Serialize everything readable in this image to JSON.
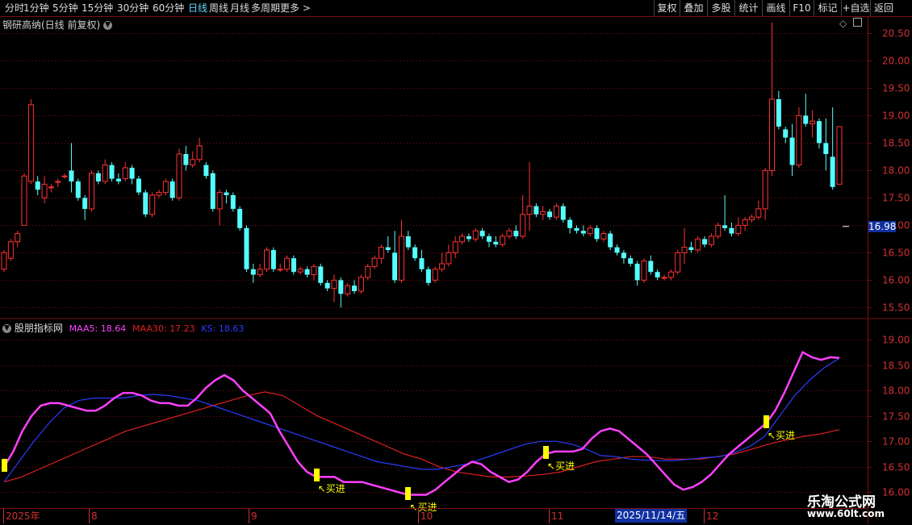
{
  "toolbar": {
    "timeframes": [
      "分时",
      "1分钟",
      "5分钟",
      "15分钟",
      "30分钟",
      "60分钟",
      "日线",
      "周线",
      "月线",
      "多周期",
      "更多 >"
    ],
    "right_buttons": [
      "复权",
      "叠加",
      "多股",
      "统计",
      "画线",
      "F10",
      "标记",
      "+自选",
      "返回"
    ]
  },
  "main_panel": {
    "title": "钢研高纳(日线 前复权)",
    "price_labels": [
      "20.50",
      "20.00",
      "19.50",
      "19.00",
      "18.50",
      "18.00",
      "17.50",
      "17.00",
      "16.50",
      "16.00",
      "15.50"
    ],
    "current_price": "16.98"
  },
  "indicator_panel": {
    "title": "股朋指标网",
    "maa5_text": "MAA5: 18.64",
    "maa30_text": "MAA30: 17.23",
    "ks_text": "KS: 18.63",
    "y_labels": [
      "19.00",
      "18.50",
      "18.00",
      "17.50",
      "17.00",
      "16.50",
      "16.00"
    ],
    "signal_label": "↖买进"
  },
  "date_axis": {
    "labels": [
      "2025年",
      "8",
      "9",
      "10",
      "11",
      "12"
    ],
    "highlight": "2025/11/14/五"
  },
  "watermark": {
    "name": "乐淘公式网",
    "url": "www.60lt.com"
  },
  "colors": {
    "up": "#ff3232",
    "down": "#54ffff",
    "grid": "#7a1010",
    "maa5": "#ff40ff",
    "maa30": "#e02020",
    "ks": "#2a3cff",
    "signal": "#ffff00"
  },
  "chart_data": {
    "type": "candlestick",
    "candles": [
      [
        16.2,
        16.5,
        16.15,
        16.55
      ],
      [
        16.4,
        16.7,
        16.35,
        16.75
      ],
      [
        16.7,
        16.85,
        16.6,
        16.9
      ],
      [
        17.0,
        17.9,
        17.0,
        17.95
      ],
      [
        17.8,
        19.2,
        17.75,
        19.3
      ],
      [
        17.8,
        17.65,
        17.55,
        17.9
      ],
      [
        17.5,
        17.75,
        17.4,
        17.9
      ],
      [
        17.7,
        17.7,
        17.6,
        17.75
      ],
      [
        17.8,
        17.8,
        17.7,
        17.85
      ],
      [
        17.9,
        17.9,
        17.85,
        17.95
      ],
      [
        18.0,
        17.8,
        17.6,
        18.5
      ],
      [
        17.8,
        17.5,
        17.45,
        17.85
      ],
      [
        17.5,
        17.3,
        17.1,
        17.55
      ],
      [
        17.3,
        17.95,
        17.25,
        18.0
      ],
      [
        17.95,
        17.8,
        17.75,
        18.0
      ],
      [
        17.8,
        18.1,
        17.75,
        18.2
      ],
      [
        18.1,
        17.85,
        17.8,
        18.15
      ],
      [
        17.85,
        17.8,
        17.75,
        17.95
      ],
      [
        17.85,
        18.05,
        17.8,
        18.15
      ],
      [
        18.05,
        17.85,
        17.75,
        18.1
      ],
      [
        17.85,
        17.6,
        17.55,
        17.9
      ],
      [
        17.6,
        17.2,
        17.15,
        17.65
      ],
      [
        17.2,
        17.55,
        17.15,
        17.6
      ],
      [
        17.55,
        17.6,
        17.5,
        17.65
      ],
      [
        17.6,
        17.8,
        17.55,
        17.85
      ],
      [
        17.8,
        17.5,
        17.45,
        17.85
      ],
      [
        17.5,
        18.3,
        17.45,
        18.4
      ],
      [
        18.3,
        18.1,
        18.0,
        18.45
      ],
      [
        18.1,
        18.2,
        18.05,
        18.35
      ],
      [
        18.2,
        18.45,
        18.15,
        18.6
      ],
      [
        18.1,
        17.9,
        17.85,
        18.15
      ],
      [
        17.95,
        17.3,
        17.25,
        18.0
      ],
      [
        17.3,
        17.6,
        17.0,
        17.65
      ],
      [
        17.6,
        17.55,
        17.4,
        17.65
      ],
      [
        17.55,
        17.3,
        17.25,
        17.6
      ],
      [
        17.3,
        16.95,
        16.9,
        17.35
      ],
      [
        16.95,
        16.2,
        16.15,
        17.0
      ],
      [
        16.2,
        16.1,
        15.95,
        16.3
      ],
      [
        16.1,
        16.2,
        16.05,
        16.3
      ],
      [
        16.2,
        16.55,
        16.15,
        16.6
      ],
      [
        16.55,
        16.2,
        16.15,
        16.6
      ],
      [
        16.2,
        16.2,
        16.15,
        16.3
      ],
      [
        16.2,
        16.4,
        16.15,
        16.45
      ],
      [
        16.4,
        16.15,
        16.1,
        16.45
      ],
      [
        16.15,
        16.2,
        16.1,
        16.25
      ],
      [
        16.2,
        16.1,
        16.05,
        16.25
      ],
      [
        16.1,
        16.25,
        16.0,
        16.3
      ],
      [
        16.25,
        15.95,
        15.9,
        16.3
      ],
      [
        15.95,
        15.85,
        15.8,
        16.0
      ],
      [
        15.85,
        16.0,
        15.6,
        16.1
      ],
      [
        16.0,
        15.75,
        15.5,
        16.05
      ],
      [
        15.75,
        15.9,
        15.7,
        15.95
      ],
      [
        15.9,
        15.8,
        15.75,
        16.0
      ],
      [
        15.8,
        16.05,
        15.75,
        16.1
      ],
      [
        16.05,
        16.25,
        16.0,
        16.3
      ],
      [
        16.25,
        16.4,
        16.2,
        16.45
      ],
      [
        16.4,
        16.6,
        16.3,
        16.65
      ],
      [
        16.6,
        16.55,
        16.5,
        16.8
      ],
      [
        16.5,
        16.0,
        15.95,
        16.9
      ],
      [
        16.0,
        16.8,
        15.95,
        17.1
      ],
      [
        16.8,
        16.6,
        16.55,
        16.9
      ],
      [
        16.6,
        16.4,
        16.35,
        16.65
      ],
      [
        16.4,
        16.2,
        16.15,
        16.55
      ],
      [
        16.2,
        15.95,
        15.9,
        16.25
      ],
      [
        16.0,
        16.2,
        15.95,
        16.25
      ],
      [
        16.2,
        16.3,
        16.15,
        16.5
      ],
      [
        16.3,
        16.5,
        16.25,
        16.65
      ],
      [
        16.5,
        16.7,
        16.4,
        16.8
      ],
      [
        16.7,
        16.8,
        16.65,
        16.85
      ],
      [
        16.8,
        16.75,
        16.7,
        16.85
      ],
      [
        16.75,
        16.9,
        16.7,
        16.95
      ],
      [
        16.9,
        16.8,
        16.75,
        16.95
      ],
      [
        16.8,
        16.7,
        16.6,
        16.85
      ],
      [
        16.7,
        16.65,
        16.6,
        16.8
      ],
      [
        16.65,
        16.8,
        16.6,
        16.85
      ],
      [
        16.8,
        16.9,
        16.75,
        16.95
      ],
      [
        16.9,
        16.8,
        16.75,
        17.0
      ],
      [
        16.8,
        17.2,
        16.75,
        17.55
      ],
      [
        17.2,
        17.35,
        16.9,
        18.15
      ],
      [
        17.35,
        17.2,
        17.15,
        17.4
      ],
      [
        17.2,
        17.25,
        17.1,
        17.35
      ],
      [
        17.25,
        17.15,
        17.1,
        17.3
      ],
      [
        17.15,
        17.35,
        17.1,
        17.4
      ],
      [
        17.35,
        17.1,
        17.05,
        17.4
      ],
      [
        17.1,
        16.95,
        16.85,
        17.15
      ],
      [
        16.95,
        16.9,
        16.85,
        17.0
      ],
      [
        16.9,
        16.85,
        16.8,
        17.0
      ],
      [
        16.85,
        16.95,
        16.8,
        17.0
      ],
      [
        16.95,
        16.75,
        16.7,
        17.0
      ],
      [
        16.75,
        16.85,
        16.7,
        16.9
      ],
      [
        16.85,
        16.6,
        16.55,
        16.9
      ],
      [
        16.6,
        16.5,
        16.45,
        16.65
      ],
      [
        16.5,
        16.4,
        16.3,
        16.55
      ],
      [
        16.4,
        16.3,
        16.25,
        16.45
      ],
      [
        16.3,
        16.0,
        15.9,
        16.35
      ],
      [
        16.0,
        16.35,
        15.95,
        16.4
      ],
      [
        16.35,
        16.15,
        16.1,
        16.45
      ],
      [
        16.15,
        16.05,
        16.0,
        16.2
      ],
      [
        16.05,
        16.05,
        16.0,
        16.1
      ],
      [
        16.05,
        16.15,
        16.0,
        16.2
      ],
      [
        16.15,
        16.5,
        16.1,
        16.55
      ],
      [
        16.5,
        16.6,
        16.3,
        16.95
      ],
      [
        16.6,
        16.55,
        16.5,
        16.7
      ],
      [
        16.55,
        16.75,
        16.5,
        16.8
      ],
      [
        16.75,
        16.65,
        16.6,
        16.8
      ],
      [
        16.65,
        16.8,
        16.6,
        16.85
      ],
      [
        16.8,
        17.0,
        16.75,
        17.05
      ],
      [
        17.0,
        16.95,
        16.9,
        17.55
      ],
      [
        16.95,
        16.85,
        16.8,
        17.05
      ],
      [
        16.85,
        17.0,
        16.8,
        17.15
      ],
      [
        17.0,
        17.1,
        16.9,
        17.15
      ],
      [
        17.1,
        17.15,
        17.05,
        17.2
      ],
      [
        17.15,
        17.3,
        17.1,
        17.45
      ],
      [
        17.3,
        18.0,
        17.1,
        18.05
      ],
      [
        18.0,
        19.3,
        17.9,
        20.7
      ],
      [
        19.3,
        18.8,
        18.75,
        19.45
      ],
      [
        18.75,
        18.6,
        18.5,
        18.8
      ],
      [
        18.6,
        18.1,
        17.9,
        18.85
      ],
      [
        18.1,
        19.0,
        18.05,
        19.15
      ],
      [
        19.0,
        18.85,
        18.8,
        19.4
      ],
      [
        18.85,
        18.9,
        18.6,
        19.1
      ],
      [
        18.9,
        18.5,
        18.4,
        18.95
      ],
      [
        18.5,
        18.3,
        18.0,
        18.95
      ],
      [
        18.25,
        17.7,
        17.65,
        19.15
      ],
      [
        17.75,
        18.8,
        17.75,
        18.8
      ]
    ],
    "current_price": 16.98,
    "y_range": [
      15.3,
      20.8
    ],
    "indicator": {
      "maa5_last": 18.64,
      "maa30_last": 17.23,
      "ks_last": 18.63,
      "y_range": [
        15.8,
        19.3
      ],
      "maa5": [
        16.5,
        16.8,
        17.2,
        17.5,
        17.7,
        17.75,
        17.75,
        17.7,
        17.65,
        17.6,
        17.6,
        17.7,
        17.85,
        17.95,
        17.95,
        17.9,
        17.8,
        17.75,
        17.75,
        17.7,
        17.7,
        17.85,
        18.05,
        18.2,
        18.3,
        18.2,
        18.0,
        17.85,
        17.7,
        17.55,
        17.2,
        16.9,
        16.6,
        16.4,
        16.3,
        16.3,
        16.3,
        16.2,
        16.2,
        16.2,
        16.15,
        16.1,
        16.05,
        16.0,
        15.95,
        15.95,
        15.95,
        16.05,
        16.2,
        16.35,
        16.5,
        16.6,
        16.55,
        16.4,
        16.3,
        16.2,
        16.25,
        16.4,
        16.6,
        16.75,
        16.8,
        16.8,
        16.8,
        16.85,
        17.05,
        17.2,
        17.25,
        17.2,
        17.05,
        16.9,
        16.75,
        16.55,
        16.35,
        16.15,
        16.05,
        16.1,
        16.2,
        16.35,
        16.55,
        16.75,
        16.9,
        17.05,
        17.2,
        17.35,
        17.6,
        17.95,
        18.35,
        18.75,
        18.65,
        18.6,
        18.65,
        18.64
      ],
      "maa30": [
        16.2,
        16.3,
        16.45,
        16.6,
        16.75,
        16.9,
        17.05,
        17.2,
        17.3,
        17.4,
        17.5,
        17.6,
        17.7,
        17.8,
        17.9,
        17.97,
        17.9,
        17.7,
        17.5,
        17.35,
        17.2,
        17.05,
        16.9,
        16.75,
        16.65,
        16.5,
        16.4,
        16.35,
        16.3,
        16.3,
        16.32,
        16.35,
        16.4,
        16.5,
        16.6,
        16.65,
        16.7,
        16.7,
        16.65,
        16.65,
        16.65,
        16.7,
        16.75,
        16.85,
        16.95,
        17.03,
        17.1,
        17.15,
        17.23
      ],
      "ks": [
        16.2,
        16.6,
        17.0,
        17.35,
        17.65,
        17.8,
        17.85,
        17.85,
        17.85,
        17.9,
        17.92,
        17.9,
        17.85,
        17.8,
        17.7,
        17.6,
        17.5,
        17.4,
        17.3,
        17.2,
        17.1,
        17.0,
        16.9,
        16.8,
        16.7,
        16.6,
        16.55,
        16.5,
        16.45,
        16.45,
        16.5,
        16.55,
        16.65,
        16.75,
        16.85,
        16.95,
        17.0,
        17.0,
        16.95,
        16.85,
        16.72,
        16.7,
        16.65,
        16.63,
        16.62,
        16.62,
        16.65,
        16.68,
        16.7,
        16.78,
        16.9,
        17.1,
        17.5,
        17.9,
        18.2,
        18.45,
        18.63
      ],
      "buy_signals": [
        0,
        34,
        44,
        59,
        83
      ]
    }
  }
}
